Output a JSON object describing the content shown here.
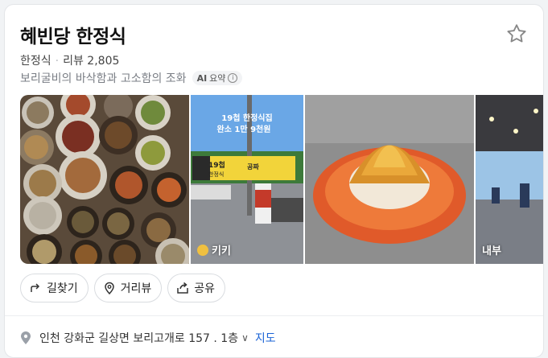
{
  "place": {
    "name": "혜빈당 한정식",
    "category": "한정식",
    "separator": "·",
    "review_label": "리뷰 2,805",
    "summary": "보리굴비의 바삭함과 고소함의 조화",
    "ai_badge_prefix": "AI",
    "ai_badge_label": "요약",
    "info_glyph": "i"
  },
  "photos": [
    {
      "name": "food-spread"
    },
    {
      "name": "restaurant-sign",
      "label": "키키"
    },
    {
      "name": "fried-dish"
    },
    {
      "name": "interior",
      "label": "내부"
    }
  ],
  "sign_overlay": {
    "line1": "19첩 한정식집",
    "line2": "완소 1만 9천원",
    "sign_main": "19첩",
    "sign_sub": "한정식",
    "sign_brand": "공짜"
  },
  "actions": [
    {
      "label": "길찾기",
      "icon": "directions-arrow-icon"
    },
    {
      "label": "거리뷰",
      "icon": "pin-icon"
    },
    {
      "label": "공유",
      "icon": "share-icon"
    }
  ],
  "address": {
    "text": "인천 강화군 길상면 보리고개로 157 . 1층",
    "chevron": "∨",
    "map_label": "지도"
  },
  "colors": {
    "link": "#1a63d6",
    "badge_bg": "#f2f3f5"
  }
}
